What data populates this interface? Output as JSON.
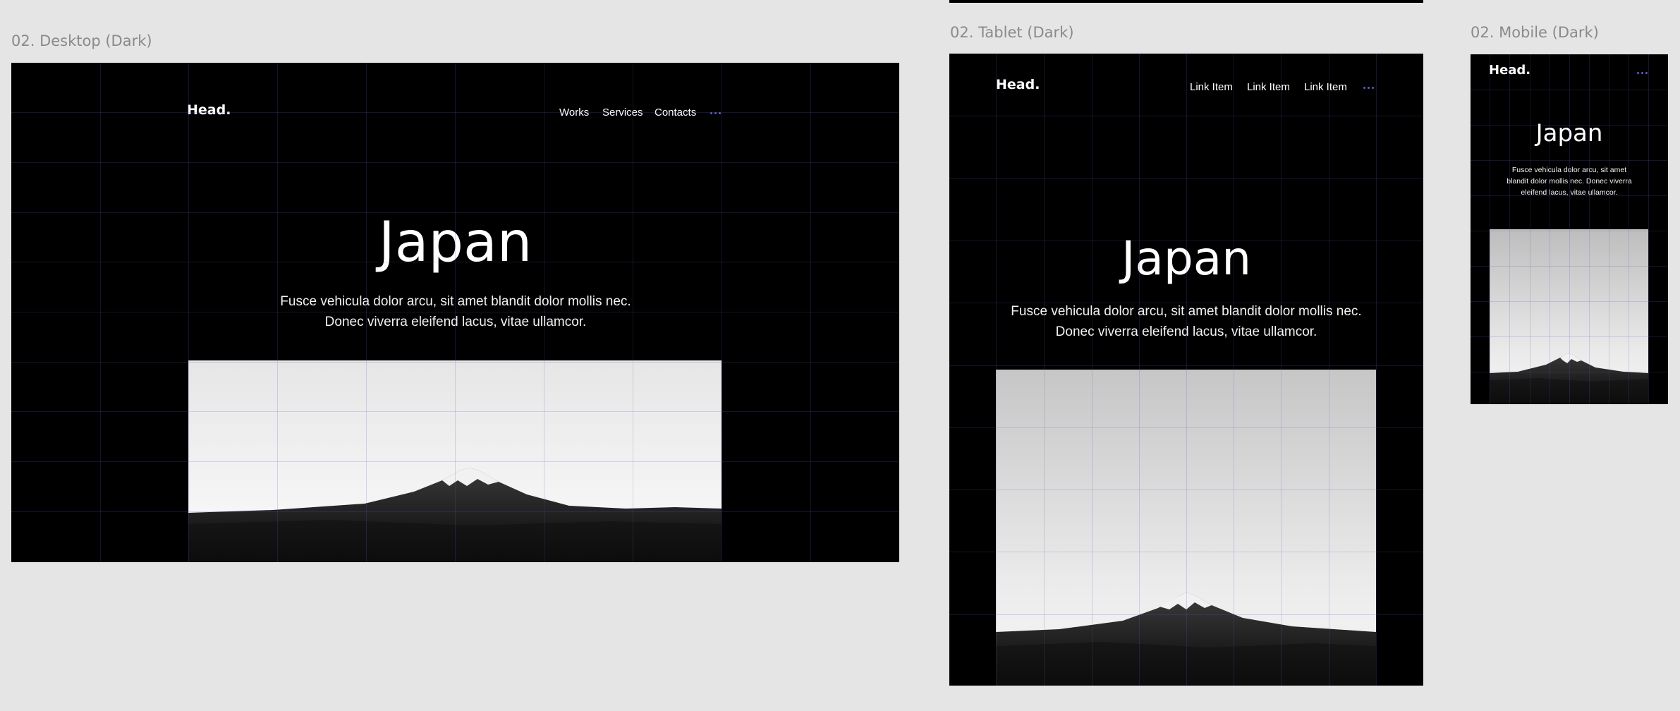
{
  "frames": {
    "desktop": {
      "label": "02. Desktop (Dark)",
      "logo": "Head.",
      "nav": [
        "Works",
        "Services",
        "Contacts"
      ],
      "title": "Japan",
      "body_line1": "Fusce vehicula dolor arcu, sit amet blandit dolor mollis nec.",
      "body_line2": "Donec viverra eleifend lacus, vitae ullamcor."
    },
    "tablet": {
      "label": "02. Tablet (Dark)",
      "logo": "Head.",
      "nav": [
        "Link Item",
        "Link Item",
        "Link Item"
      ],
      "title": "Japan",
      "body_line1": "Fusce vehicula dolor arcu, sit amet blandit dolor mollis nec.",
      "body_line2": "Donec viverra eleifend lacus, vitae ullamcor."
    },
    "mobile": {
      "label": "02. Mobile (Dark)",
      "logo": "Head.",
      "title": "Japan",
      "body": "Fusce vehicula dolor arcu, sit amet blandit dolor mollis nec. Donec viverra eleifend lacus, vitae ullamcor."
    }
  },
  "icons": {
    "menu": "more-dots-icon"
  },
  "colors": {
    "canvas": "#e5e5e5",
    "frame_background": "#000000",
    "grid_line": "#5c5cc8",
    "menu_dots": "#5a5fc8",
    "label_text": "#8a8a8a"
  }
}
